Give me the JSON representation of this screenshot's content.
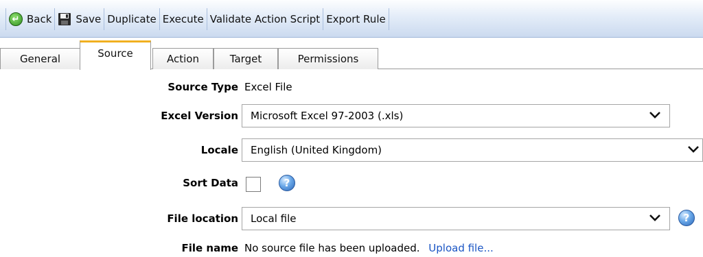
{
  "toolbar": {
    "buttons": [
      {
        "label": "Back",
        "icon": "back-arrow-icon"
      },
      {
        "label": "Save",
        "icon": "floppy-disk-icon"
      },
      {
        "label": "Duplicate"
      },
      {
        "label": "Execute"
      },
      {
        "label": "Validate Action Script"
      },
      {
        "label": "Export Rule"
      }
    ]
  },
  "tabs": [
    {
      "label": "General",
      "active": false
    },
    {
      "label": "Source",
      "active": true
    },
    {
      "label": "Action",
      "active": false
    },
    {
      "label": "Target",
      "active": false
    },
    {
      "label": "Permissions",
      "active": false
    }
  ],
  "form": {
    "source_type": {
      "label": "Source Type",
      "value": "Excel File"
    },
    "excel_version": {
      "label": "Excel Version",
      "value": "Microsoft Excel 97-2003 (.xls)"
    },
    "locale": {
      "label": "Locale",
      "value": "English (United Kingdom)"
    },
    "sort_data": {
      "label": "Sort Data",
      "checked": false,
      "help_icon": "help-icon"
    },
    "file_location": {
      "label": "File location",
      "value": "Local file",
      "help_icon": "help-icon"
    },
    "file_name": {
      "label": "File name",
      "value": "No source file has been uploaded.",
      "link": "Upload file..."
    }
  },
  "colors": {
    "toolbar_top": "#fdfeff",
    "toolbar_bottom": "#cbdaef",
    "active_tab_accent": "#f0b020",
    "link": "#1a55c4"
  }
}
